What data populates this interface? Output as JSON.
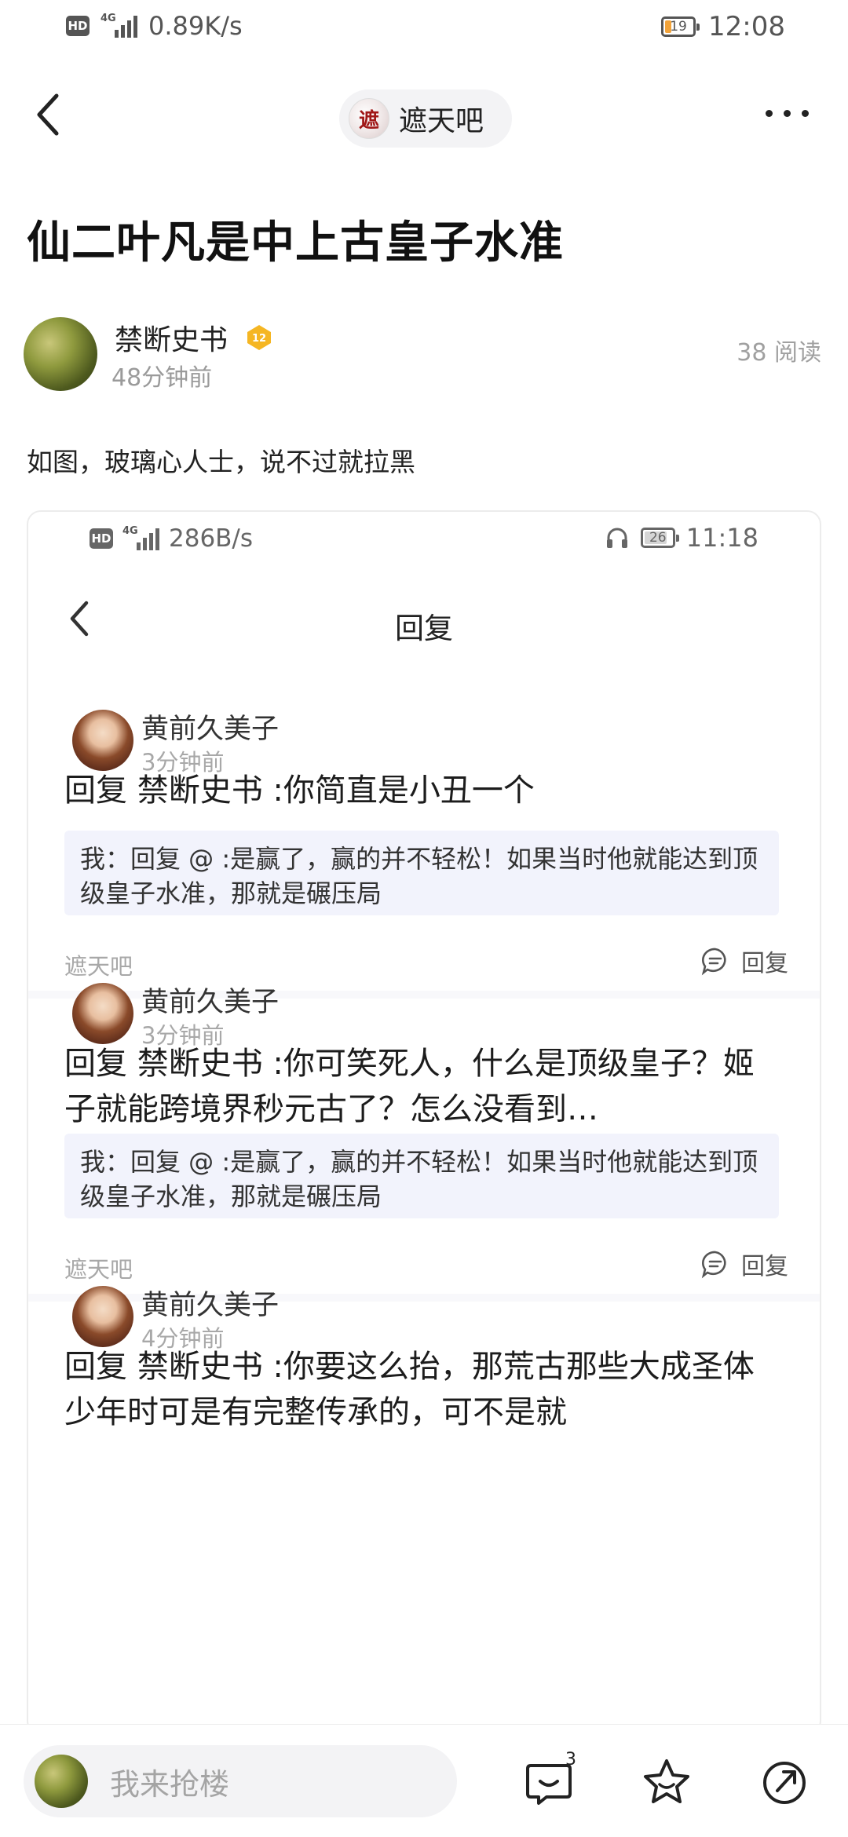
{
  "status_bar": {
    "network_speed": "0.89K/s",
    "battery_level": "19",
    "time": "12:08",
    "hd_label": "HD",
    "net_label": "4G"
  },
  "nav": {
    "forum_name": "遮天吧",
    "forum_logo_text": "遮"
  },
  "post": {
    "title": "仙二叶凡是中上古皇子水准",
    "author": "禁断史书",
    "level": "12",
    "time": "48分钟前",
    "read_count": "38 阅读",
    "body": "如图，玻璃心人士，说不过就拉黑"
  },
  "embedded": {
    "status_bar": {
      "network_speed": "286B/s",
      "battery_level": "26",
      "time": "11:18",
      "hd_label": "HD",
      "net_label": "4G"
    },
    "title": "回复",
    "replies": [
      {
        "name": "黄前久美子",
        "time": "3分钟前",
        "text": "回复  禁断史书 :你简直是小丑一个",
        "quote": "我：回复 @ :是赢了，赢的并不轻松！如果当时他就能达到顶级皇子水准，那就是碾压局",
        "forum": "遮天吧",
        "reply_label": "回复"
      },
      {
        "name": "黄前久美子",
        "time": "3分钟前",
        "text": "回复  禁断史书 :你可笑死人，什么是顶级皇子？姬子就能跨境界秒元古了？怎么没看到…",
        "quote": "我：回复 @ :是赢了，赢的并不轻松！如果当时他就能达到顶级皇子水准，那就是碾压局",
        "forum": "遮天吧",
        "reply_label": "回复"
      },
      {
        "name": "黄前久美子",
        "time": "4分钟前",
        "text": "回复  禁断史书 :你要这么抬，那荒古那些大成圣体少年时可是有完整传承的，可不是就"
      }
    ]
  },
  "bottom_bar": {
    "comment_placeholder": "我来抢楼",
    "comment_count": "3"
  }
}
